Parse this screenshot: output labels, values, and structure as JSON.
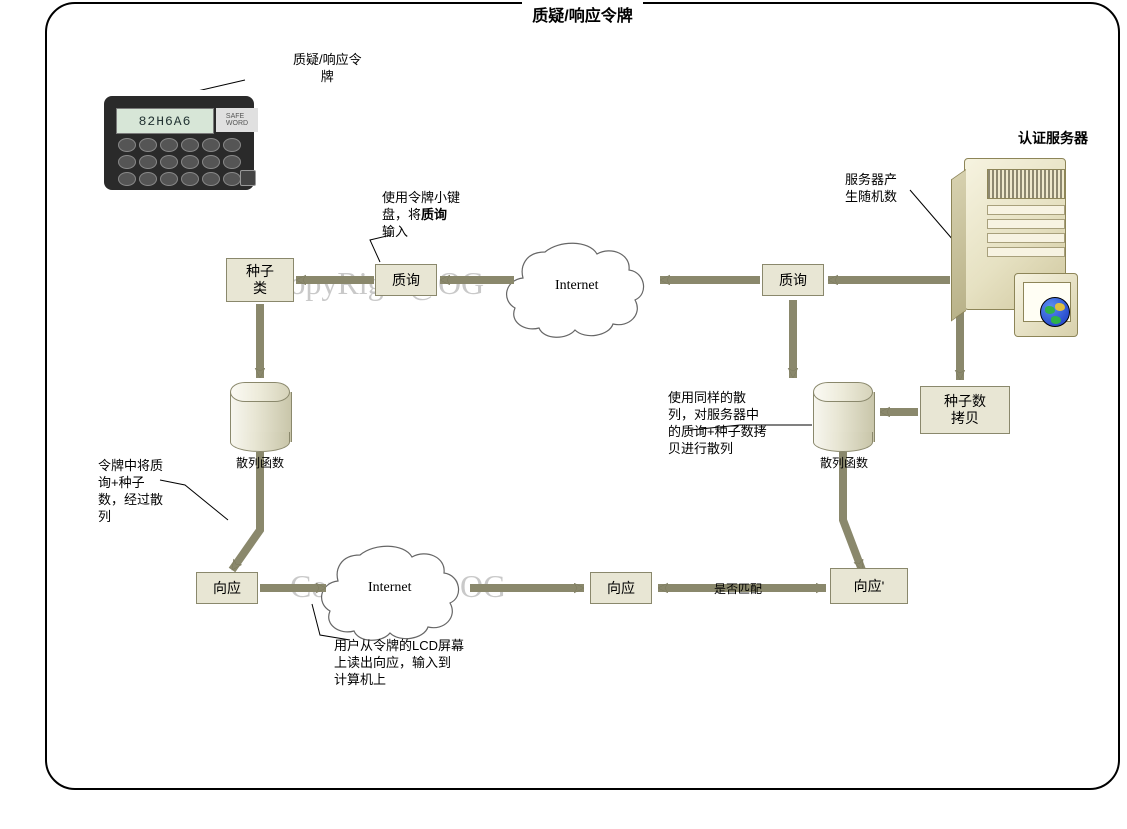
{
  "title": "质疑/响应令牌",
  "watermark1": "CopyRight@OG",
  "watermark2": "CopyRight@OG",
  "token": {
    "caption": "质疑/响应令",
    "caption2": "牌",
    "lcd": "82H6A6",
    "brand": "SAFE\nWORD"
  },
  "labels": {
    "auth_server": "认证服务器",
    "server_gen": "服务器产",
    "server_gen2": "生随机数",
    "keypad_note_l1": "使用令牌小键",
    "keypad_note_l2_p1": "盘，将",
    "keypad_note_l2_p2": "质询",
    "keypad_note_l3": "输入",
    "hash1": "散列函数",
    "hash2": "散列函数",
    "token_hash_l1": "令牌中将质",
    "token_hash_l2": "询+种子",
    "token_hash_l3": "数，经过散",
    "token_hash_l4": "列",
    "server_hash_l1": "使用同样的散",
    "server_hash_l2": "列，对服务器中",
    "server_hash_l3": "的质询+种子数拷",
    "server_hash_l4": "贝进行散列",
    "lcd_read_l1": "用户从令牌的LCD屏幕",
    "lcd_read_l2": "上读出向应，输入到",
    "lcd_read_l3": "计算机上",
    "match": "是否匹配",
    "internet1": "Internet",
    "internet2": "Internet"
  },
  "boxes": {
    "seed_class_l1": "种子",
    "seed_class_l2": "类",
    "query_left": "质询",
    "query_right": "质询",
    "seed_copy_l1": "种子数",
    "seed_copy_l2": "拷贝",
    "resp_left": "向应",
    "resp_mid": "向应",
    "resp_right": "向应'"
  }
}
